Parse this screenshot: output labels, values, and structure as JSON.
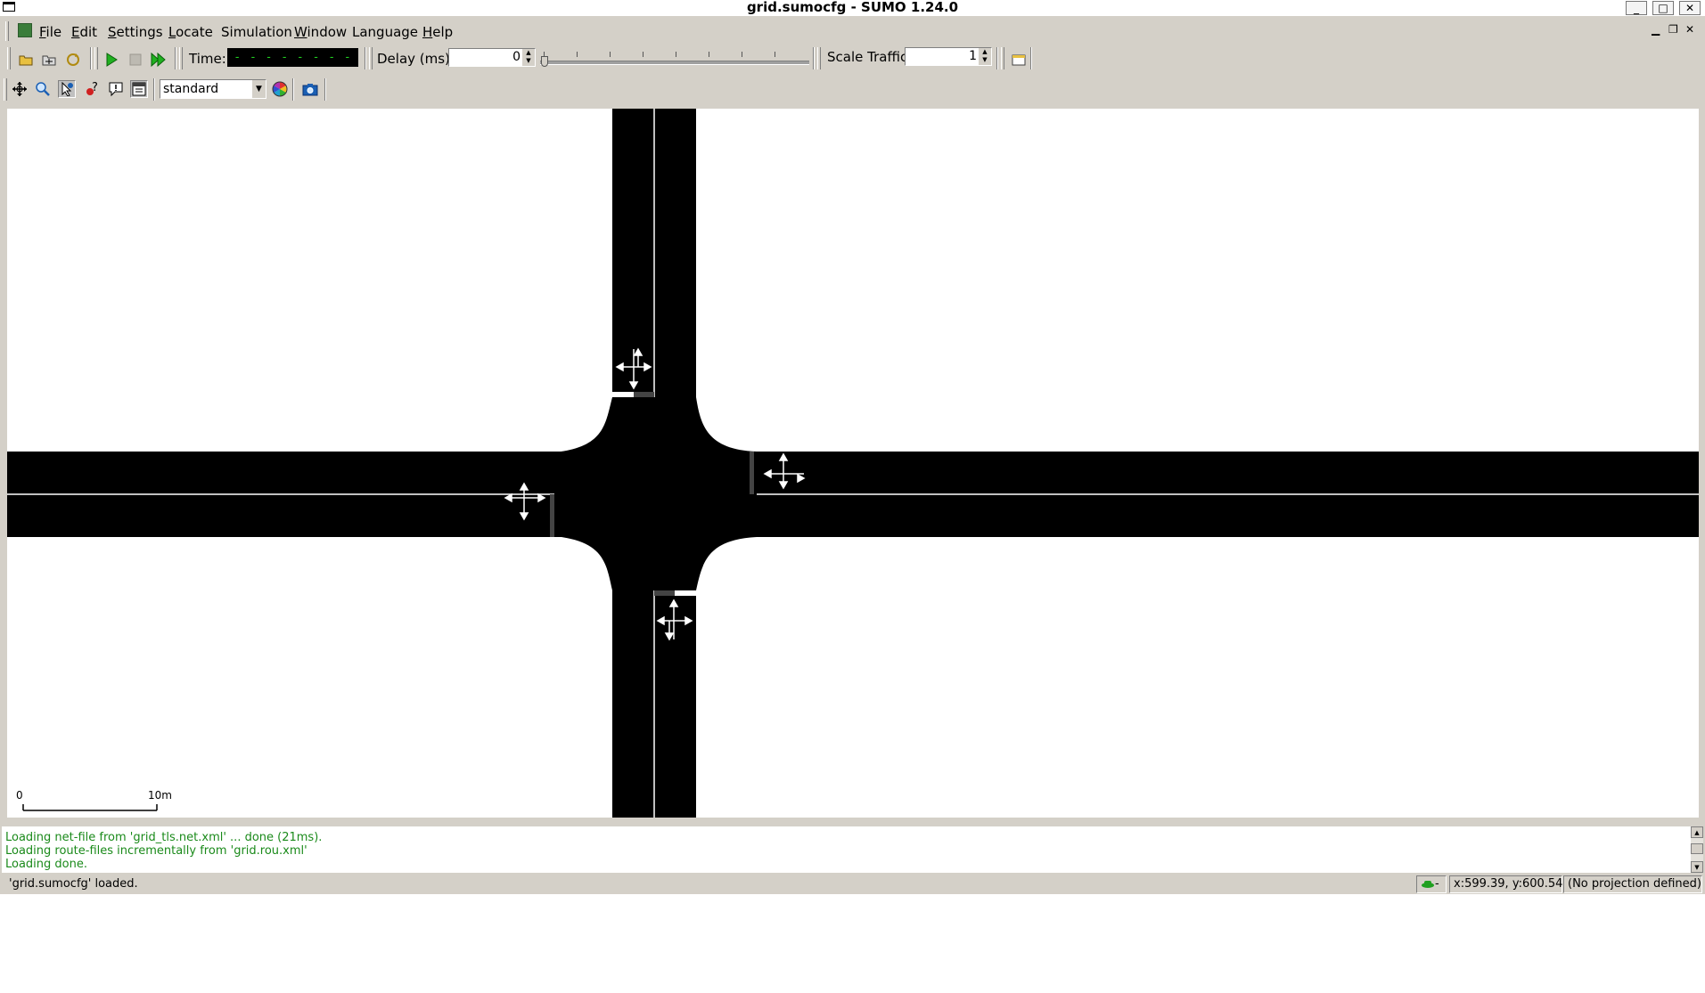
{
  "window": {
    "title": "grid.sumocfg - SUMO 1.24.0",
    "minimize": "_",
    "maximize": "□",
    "close": "✕"
  },
  "menu": [
    {
      "acc": "F",
      "rest": "ile"
    },
    {
      "acc": "E",
      "rest": "dit"
    },
    {
      "acc": "S",
      "rest": "ettings"
    },
    {
      "acc": "L",
      "rest": "ocate"
    },
    {
      "acc": "",
      "rest": "Simulation"
    },
    {
      "acc": "W",
      "rest": "indow"
    },
    {
      "acc": "",
      "rest": "Language"
    },
    {
      "acc": "H",
      "rest": "elp"
    }
  ],
  "toolbar": {
    "time_label": "Time:",
    "time_display": "- - - - - - - - - - - - - - -",
    "delay_label": "Delay (ms):",
    "delay_value": "0",
    "scale_label": "Scale Traffic:",
    "scale_value": "1"
  },
  "view_toolbar": {
    "scheme": "standard",
    "icons": [
      "recenter-icon",
      "zoom-icon",
      "select-mode-icon",
      "locate-icon",
      "tooltip-icon",
      "menu-icon",
      "color-wheel-icon",
      "screenshot-icon"
    ]
  },
  "scale_bar": {
    "start": "0",
    "end": "10m"
  },
  "messages": [
    "Loading net-file from 'grid_tls.net.xml' ... done (21ms).",
    "Loading route-files incrementally from 'grid.rou.xml'",
    "Loading done."
  ],
  "status": {
    "main": "'grid.sumocfg' loaded.",
    "vehicle_indicator": "-",
    "coordinates": "x:599.39, y:600.54",
    "projection": "(No projection defined)"
  },
  "colors": {
    "road": "#000000",
    "lane_marking": "#ffffff",
    "message_text": "#1a8a1a",
    "lcd_text": "#20d020"
  }
}
